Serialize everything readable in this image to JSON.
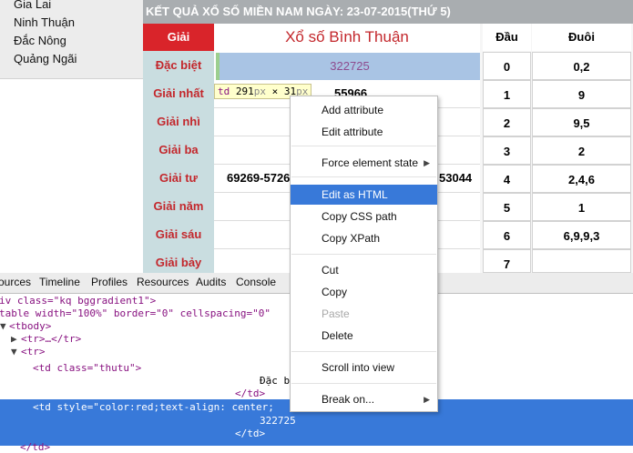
{
  "provinces": [
    "Gia Lai",
    "Ninh Thuận",
    "Đắc Nông",
    "Quảng Ngãi"
  ],
  "header_title": "KẾT QUẢ XỔ SỐ MIỀN NAM NGÀY: 23-07-2015(THỨ 5)",
  "results": {
    "col_prize": "Giải",
    "col_lottery": "Xổ số Bình Thuận",
    "rows": [
      {
        "label": "Đặc biệt",
        "value": "322725"
      },
      {
        "label": "Giải nhất",
        "value": "55966"
      },
      {
        "label": "Giải nhì",
        "value": ""
      },
      {
        "label": "Giải ba",
        "value": ""
      },
      {
        "label": "Giải tư",
        "value_left": "69269-5726",
        "value_right": "53044"
      },
      {
        "label": "Giải năm",
        "value": ""
      },
      {
        "label": "Giải sáu",
        "value": ""
      },
      {
        "label": "Giải bảy",
        "value": ""
      }
    ]
  },
  "dau_duoi": {
    "col_dau": "Đầu",
    "col_duoi": "Đuôi",
    "rows": [
      {
        "dau": "0",
        "duoi": "0,2"
      },
      {
        "dau": "1",
        "duoi": "9"
      },
      {
        "dau": "2",
        "duoi": "9,5"
      },
      {
        "dau": "3",
        "duoi": "2"
      },
      {
        "dau": "4",
        "duoi": "2,4,6"
      },
      {
        "dau": "5",
        "duoi": "1"
      },
      {
        "dau": "6",
        "duoi": "6,9,9,3"
      },
      {
        "dau": "7",
        "duoi": ""
      }
    ]
  },
  "tooltip": {
    "tag": "td",
    "w": "291",
    "px1": "px",
    "x": "×",
    "h": "31",
    "px2": "px"
  },
  "devtools": {
    "tabs": [
      "ources",
      "Timeline",
      "Profiles",
      "Resources",
      "Audits",
      "Console"
    ],
    "lines": [
      "iv class=\"kq bggradient1\">",
      "table width=\"100%\" border=\"0\" cellspacing=\"0\"",
      "<tbody>",
      "<tr>…</tr>",
      "<tr>",
      "<td class=\"thutu\">",
      "Đặc b",
      "</td>",
      "<td style=\"color:red;text-align: center;",
      "322725",
      "</td>",
      "</td>"
    ]
  },
  "context_menu": {
    "items": [
      {
        "label": "Add attribute"
      },
      {
        "label": "Edit attribute"
      },
      {
        "label": "Force element state"
      },
      {
        "label": "Edit as HTML"
      },
      {
        "label": "Copy CSS path"
      },
      {
        "label": "Copy XPath"
      },
      {
        "label": "Cut"
      },
      {
        "label": "Copy"
      },
      {
        "label": "Paste"
      },
      {
        "label": "Delete"
      },
      {
        "label": "Scroll into view"
      },
      {
        "label": "Break on..."
      }
    ]
  },
  "colors": {
    "accent_red": "#d9242a",
    "selection_blue": "#3879d9",
    "label_bg": "#c9dde0"
  }
}
